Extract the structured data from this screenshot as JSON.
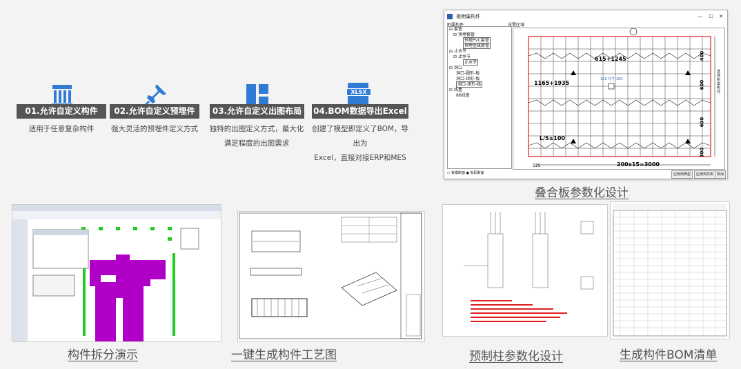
{
  "features": [
    {
      "label": "01.允许自定义构件",
      "desc_lines": [
        "适用于任意复杂构件"
      ],
      "icon": "building-icon"
    },
    {
      "label": "02.允许自定义预埋件",
      "desc_lines": [
        "强大灵活的预埋件定义方式"
      ],
      "icon": "pushpin-icon"
    },
    {
      "label": "03.允许自定义出图布局",
      "desc_lines": [
        "独特的出图定义方式，最大化",
        "满足程度的出图需求"
      ],
      "icon": "layout-icon"
    },
    {
      "label": "04.BOM数据导出Excel",
      "desc_lines": [
        "创建了模型即定义了BOM，导出为",
        "Excel，直接对接ERP和MES"
      ],
      "icon": "xlsx-icon"
    }
  ],
  "xlsx_text": "XLSX",
  "window": {
    "title": "板附属构件",
    "tree_header": "附属构件",
    "canvas_header": "设置区域",
    "tree_items": [
      "套管",
      "预埋套管",
      "预埋PVC套管",
      "预埋金属套管",
      "止水节",
      "止水节",
      "止水节",
      "洞口",
      "洞口-圆形-板",
      "洞口-矩形-板",
      "洞口-矩形-板",
      "线盒",
      "86线盒"
    ],
    "dims": {
      "d1": "615+1245",
      "d2": "1165+1935",
      "d3": "L/5±100",
      "d4": "200x15=3000",
      "d5": "125",
      "v1": "400",
      "v2": "600",
      "v3": "600",
      "v4": "300",
      "small": "100",
      "small_suffix": "尺寸 100"
    },
    "side_text": "选择所需构件",
    "radio1": "板模断面",
    "radio2": "板配断面",
    "btn1": "应用到典型",
    "btn2": "应用到实例",
    "btn3": "取消"
  },
  "captions": {
    "stack": "叠合板参数化设计",
    "split": "构件拆分演示",
    "process": "一键生成构件工艺图",
    "column": "预制柱参数化设计",
    "bom": "生成构件BOM清单"
  },
  "colors": {
    "label_bg": "#555555",
    "icon_blue": "#2f7bd6",
    "magenta": "#b000c8",
    "red_line": "#e02020",
    "green": "#22cc22"
  }
}
